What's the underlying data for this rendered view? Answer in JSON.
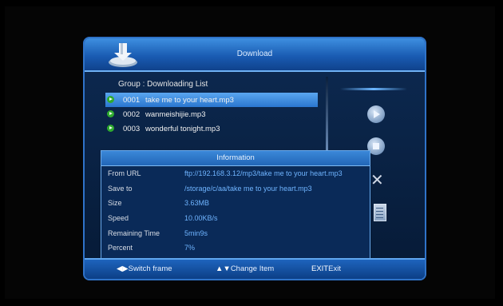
{
  "window": {
    "title": "Download"
  },
  "list": {
    "group_label": "Group : Downloading List",
    "items": [
      {
        "num": "0001",
        "name": "take me to your heart.mp3",
        "selected": true
      },
      {
        "num": "0002",
        "name": "wanmeishijie.mp3",
        "selected": false
      },
      {
        "num": "0003",
        "name": "wonderful tonight.mp3",
        "selected": false
      }
    ]
  },
  "info": {
    "title": "Information",
    "rows": [
      {
        "label": "From URL",
        "value": "ftp://192.168.3.12/mp3/take me to your heart.mp3"
      },
      {
        "label": "Save to",
        "value": "/storage/c/aa/take me to your heart.mp3"
      },
      {
        "label": "Size",
        "value": "3.63MB"
      },
      {
        "label": "Speed",
        "value": "10.00KB/s"
      },
      {
        "label": "Remaining Time",
        "value": "5min9s"
      },
      {
        "label": "Percent",
        "value": "7%"
      }
    ]
  },
  "footer": {
    "switch": {
      "key": "◀▶",
      "label": "Switch frame"
    },
    "change": {
      "key": "▲▼",
      "label": "Change Item"
    },
    "exit": {
      "key": "EXIT",
      "label": "Exit"
    }
  },
  "icons": [
    "download-icon",
    "play-icon",
    "stop-icon",
    "delete-icon",
    "edit-icon"
  ]
}
